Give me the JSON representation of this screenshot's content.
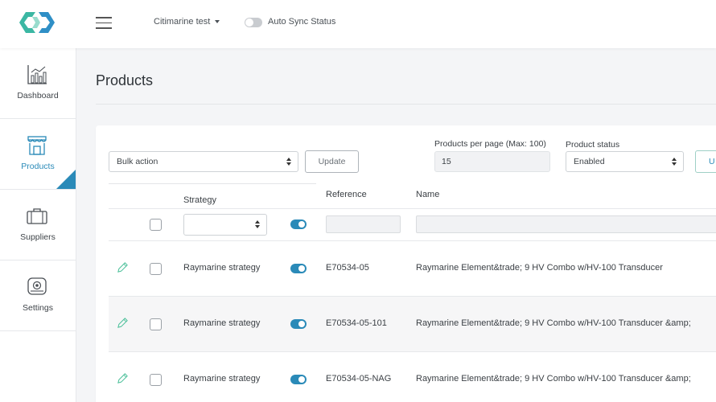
{
  "header": {
    "company": "Citimarine test",
    "auto_sync_label": "Auto Sync Status",
    "auto_sync_on": false
  },
  "sidebar": {
    "items": [
      {
        "label": "Dashboard",
        "icon": "chart-icon",
        "active": false
      },
      {
        "label": "Products",
        "icon": "store-icon",
        "active": true
      },
      {
        "label": "Suppliers",
        "icon": "briefcase-icon",
        "active": false
      },
      {
        "label": "Settings",
        "icon": "gear-box-icon",
        "active": false
      }
    ]
  },
  "page": {
    "title": "Products"
  },
  "toolbar": {
    "bulk_action": "Bulk action",
    "update_label": "Update",
    "per_page_label": "Products per page (Max: 100)",
    "per_page_value": "15",
    "status_label": "Product status",
    "status_value": "Enabled",
    "update2_label": "U"
  },
  "table": {
    "columns": {
      "strategy": "Strategy",
      "reference": "Reference",
      "name": "Name"
    },
    "rows": [
      {
        "strategy": "Raymarine strategy",
        "enabled": true,
        "reference": "E70534-05",
        "name": "Raymarine Element&trade; 9 HV Combo w/HV-100 Transducer"
      },
      {
        "strategy": "Raymarine strategy",
        "enabled": true,
        "reference": "E70534-05-101",
        "name": "Raymarine Element&trade; 9 HV Combo w/HV-100 Transducer &amp;"
      },
      {
        "strategy": "Raymarine strategy",
        "enabled": true,
        "reference": "E70534-05-NAG",
        "name": "Raymarine Element&trade; 9 HV Combo w/HV-100 Transducer &amp;"
      }
    ]
  },
  "colors": {
    "accent": "#2a8ab8",
    "logo_teal": "#3bb7a3",
    "logo_blue": "#2f8fc6"
  }
}
